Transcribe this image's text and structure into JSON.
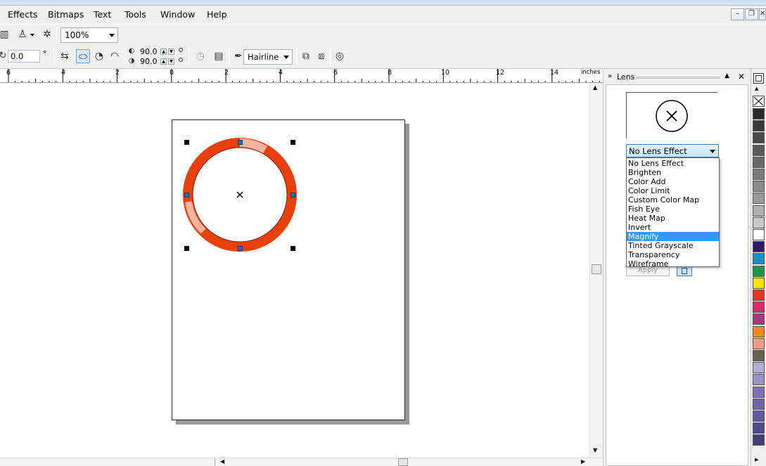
{
  "menu": {
    "items": [
      "Effects",
      "Bitmaps",
      "Text",
      "Tools",
      "Window",
      "Help"
    ]
  },
  "window_buttons": {
    "minimize": "–",
    "restore": "❐",
    "close": "✕"
  },
  "toolbar": {
    "zoom": "100%",
    "rotation": "0.0",
    "degree_symbol": "°",
    "angle_start": "90.0",
    "angle_end": "90.0",
    "outline_width": "Hairline"
  },
  "ruler": {
    "unit": "inches",
    "labels": [
      "6",
      "4",
      "2",
      "0",
      "2",
      "4",
      "6",
      "8",
      "10",
      "12",
      "14"
    ]
  },
  "docker": {
    "title": "Lens",
    "selected": "No Lens Effect",
    "highlighted_index": 8,
    "options": [
      "No Lens Effect",
      "Brighten",
      "Color Add",
      "Color Limit",
      "Custom Color Map",
      "Fish Eye",
      "Heat Map",
      "Invert",
      "Magnify",
      "Tinted Grayscale",
      "Transparency",
      "Wireframe"
    ],
    "apply_label": "Apply"
  },
  "colors": {
    "ring": "#e8400c",
    "ring_highlight": "#f8b49c",
    "node": "#1e73be",
    "highlight": "#3399ff"
  },
  "palette": [
    "#2b2b2b",
    "#3a3a3a",
    "#4a4a4a",
    "#5a5a5a",
    "#6a6a6a",
    "#7a7a7a",
    "#8a8a8a",
    "#9a9a9a",
    "#b0b0b0",
    "#c8c8c8",
    "#ffffff",
    "#2e1a6e",
    "#1e8fd6",
    "#199a4a",
    "#f5e600",
    "#e63b1a",
    "#e0266b",
    "#a33a79",
    "#f08a1a",
    "#f59a8a",
    "#6a6052",
    "#b3aad8",
    "#9a90c8",
    "#8070b8",
    "#7064a8",
    "#6058a0",
    "#504b8a",
    "#404078"
  ]
}
